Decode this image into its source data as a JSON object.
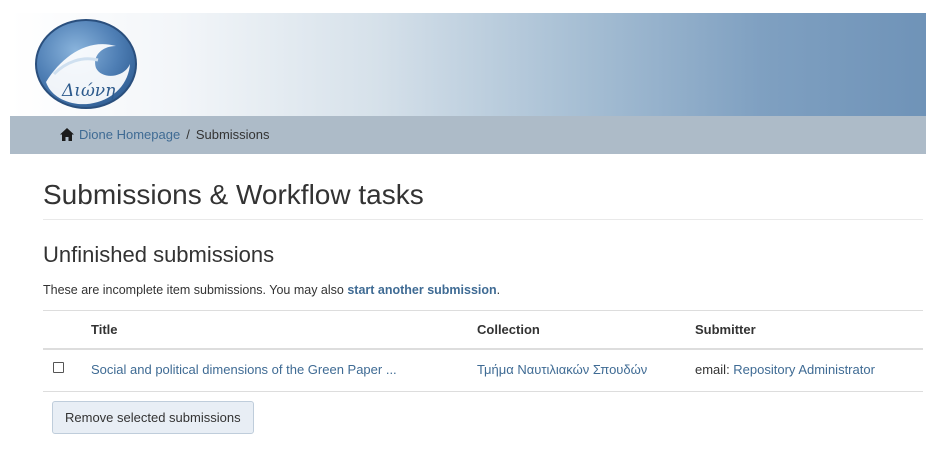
{
  "logo": {
    "text": "Διώνη",
    "icon": "dione-wave-logo"
  },
  "breadcrumb": {
    "home_icon": "home-icon",
    "home_label": "Dione Homepage",
    "separator": "/",
    "current": "Submissions"
  },
  "page": {
    "title": "Submissions & Workflow tasks"
  },
  "unfinished": {
    "heading": "Unfinished submissions",
    "intro_prefix": "These are incomplete item submissions. You may also ",
    "intro_link": "start another submission",
    "intro_suffix": "."
  },
  "table": {
    "headers": [
      "Title",
      "Collection",
      "Submitter"
    ],
    "rows": [
      {
        "checked": false,
        "title": "Social and political dimensions of the Green Paper ...",
        "collection": "Τμήμα Ναυτιλιακών Σπουδών",
        "submitter_prefix": "email: ",
        "submitter_name": "Repository Administrator"
      }
    ]
  },
  "actions": {
    "remove_label": "Remove selected submissions"
  },
  "colors": {
    "link": "#3f6b94",
    "breadcrumb_bar": "#adbbc8",
    "banner_end": "#6f93b8"
  }
}
